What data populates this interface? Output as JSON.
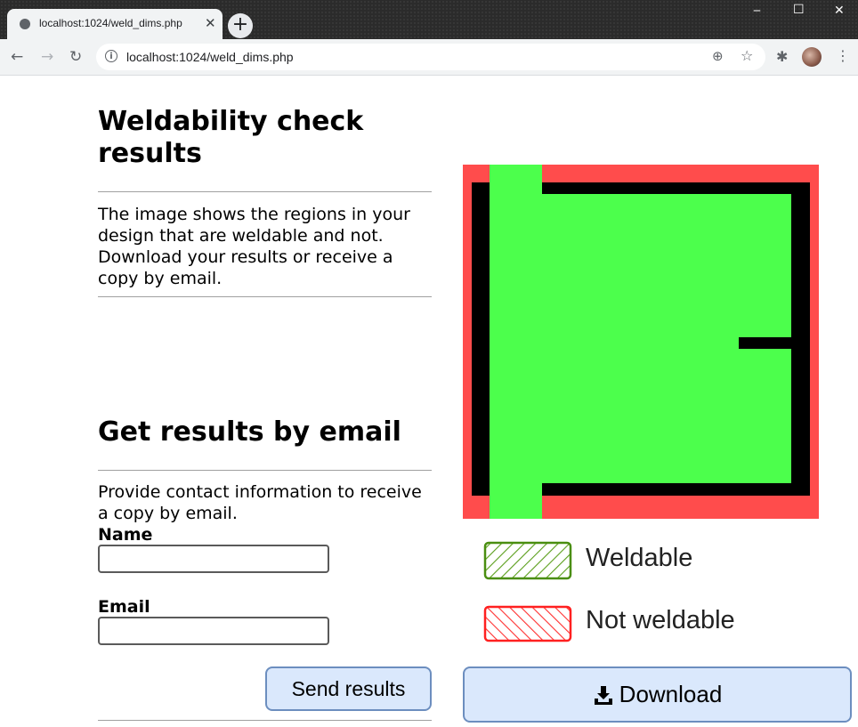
{
  "browser": {
    "tab_title": "localhost:1024/weld_dims.php",
    "url": "localhost:1024/weld_dims.php"
  },
  "results": {
    "heading": "Weldability check results",
    "description": "The image shows the regions in your design that are weldable and not. Download your results or receive a copy by email."
  },
  "email_section": {
    "heading": "Get results by email",
    "description": "Provide contact information to receive a copy by email.",
    "name_label": "Name",
    "name_value": "",
    "email_label": "Email",
    "email_value": "",
    "send_label": "Send results"
  },
  "legend": {
    "weldable_label": "Weldable",
    "weldable_color": "#4cff4c",
    "not_weldable_label": "Not weldable",
    "not_weldable_color": "#ff4c4c"
  },
  "download": {
    "label": "Download",
    "icon": "download-icon"
  }
}
